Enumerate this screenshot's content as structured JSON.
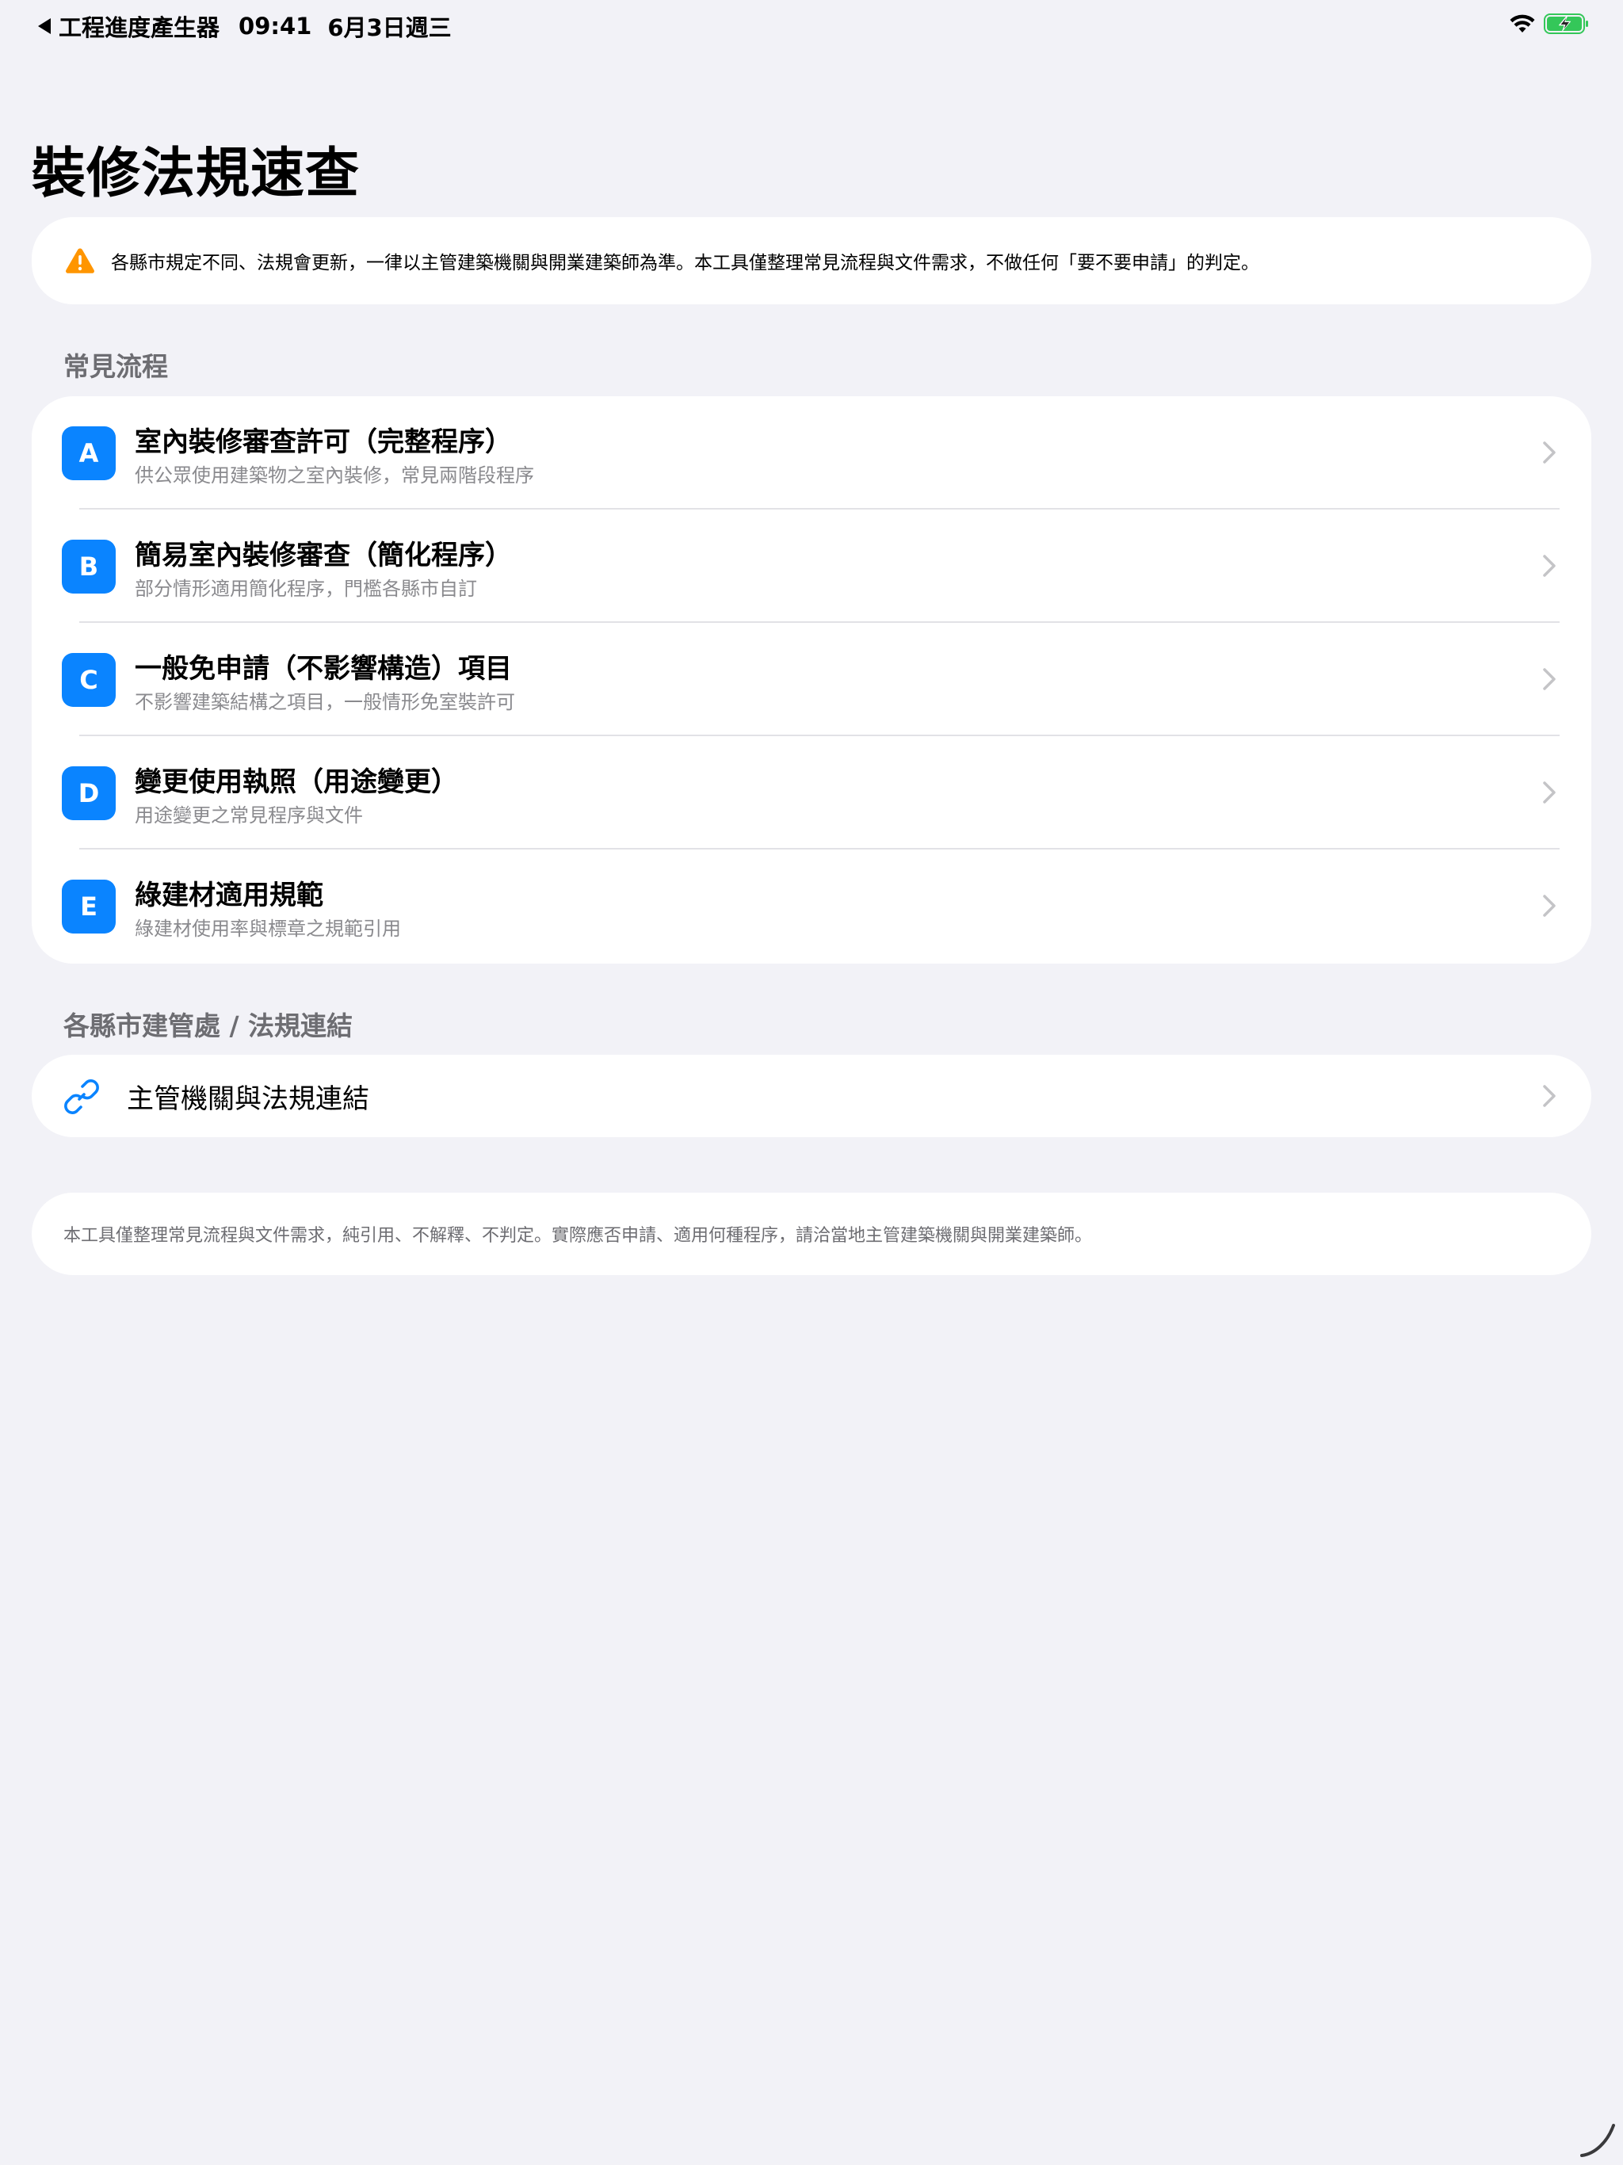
{
  "status_bar": {
    "back_app": "工程進度產生器",
    "time": "09:41",
    "date": "6月3日週三",
    "icons": [
      "wifi-icon",
      "battery-charging-icon"
    ]
  },
  "page": {
    "title": "裝修法規速查"
  },
  "warning": {
    "icon": "warning-triangle-icon",
    "icon_color": "#ff9500",
    "text": "各縣市規定不同、法規會更新，一律以主管建築機關與開業建築師為準。本工具僅整理常見流程與文件需求，不做任何「要不要申請」的判定。"
  },
  "sections": {
    "flows_header": "常見流程",
    "links_header": "各縣市建管處 / 法規連結"
  },
  "flows": [
    {
      "badge": "A",
      "title": "室內裝修審查許可（完整程序）",
      "subtitle": "供公眾使用建築物之室內裝修，常見兩階段程序"
    },
    {
      "badge": "B",
      "title": "簡易室內裝修審查（簡化程序）",
      "subtitle": "部分情形適用簡化程序，門檻各縣市自訂"
    },
    {
      "badge": "C",
      "title": "一般免申請（不影響構造）項目",
      "subtitle": "不影響建築結構之項目，一般情形免室裝許可"
    },
    {
      "badge": "D",
      "title": "變更使用執照（用途變更）",
      "subtitle": "用途變更之常見程序與文件"
    },
    {
      "badge": "E",
      "title": "綠建材適用規範",
      "subtitle": "綠建材使用率與標章之規範引用"
    }
  ],
  "links": {
    "icon": "link-icon",
    "label": "主管機關與法規連結"
  },
  "footer": {
    "text": "本工具僅整理常見流程與文件需求，純引用、不解釋、不判定。實際應否申請、適用何種程序，請洽當地主管建築機關與開業建築師。"
  },
  "colors": {
    "accent": "#0a84ff",
    "background": "#f2f2f7",
    "battery": "#34c759"
  }
}
